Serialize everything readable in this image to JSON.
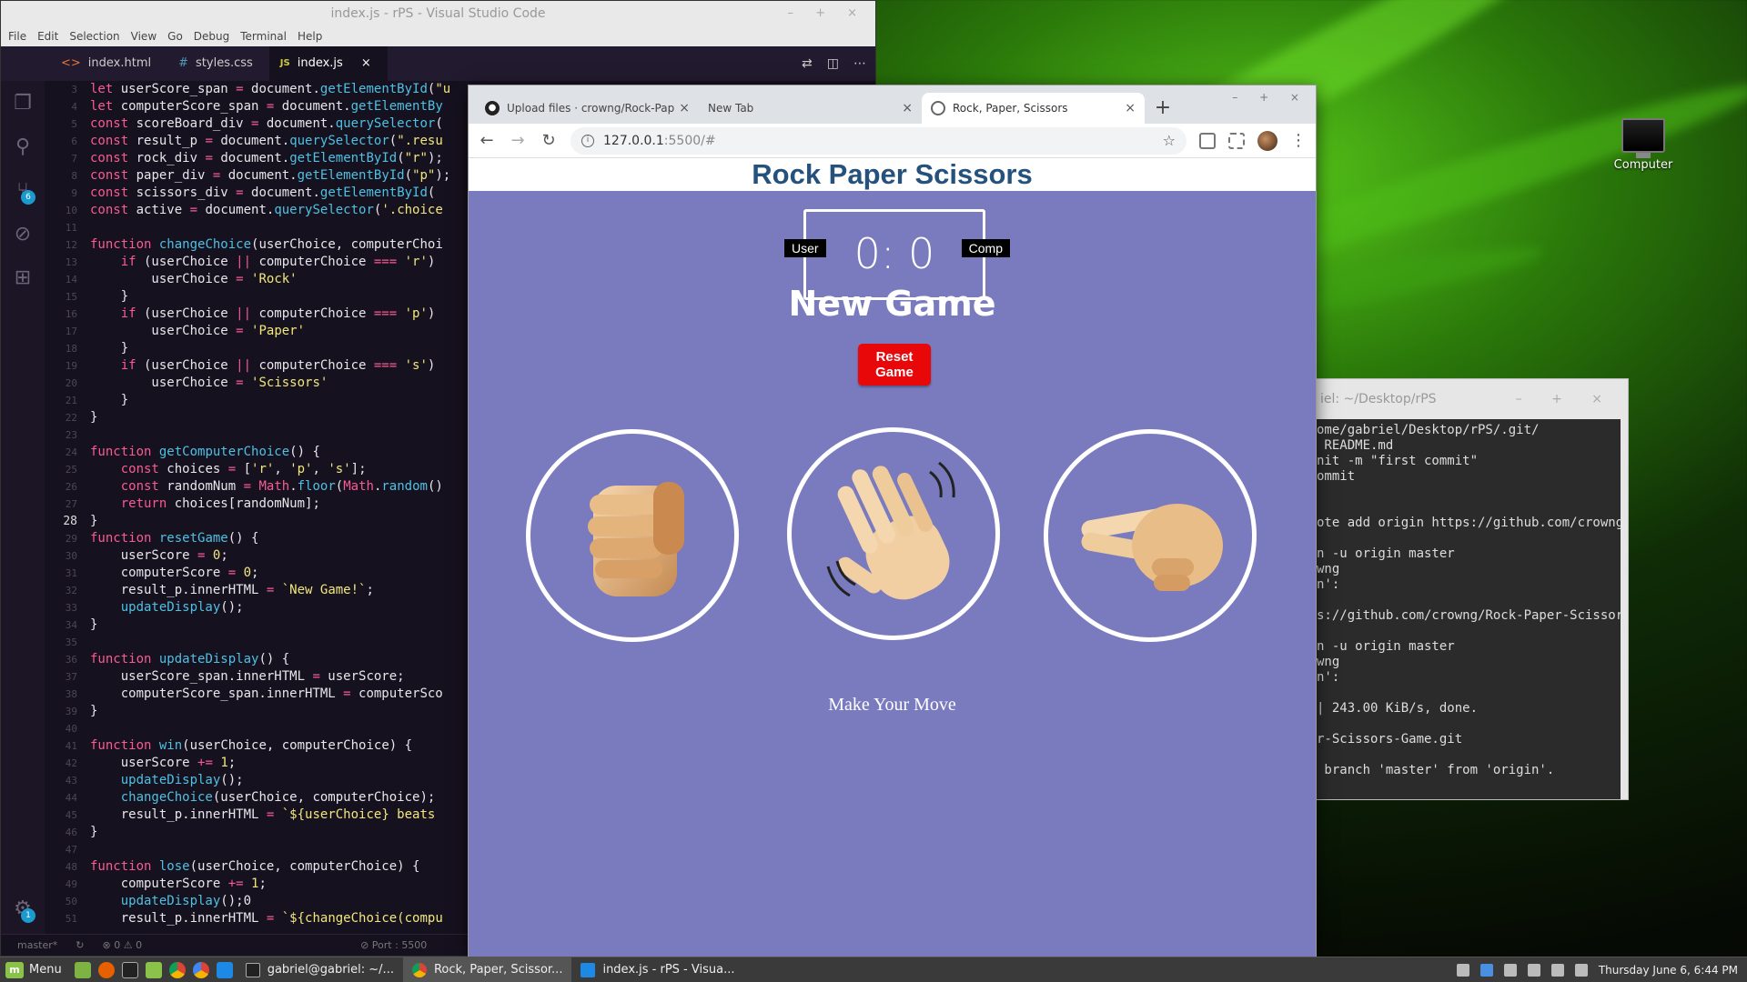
{
  "vscode": {
    "title": "index.js - rPS - Visual Studio Code",
    "window_controls": "– + ×",
    "menu": [
      "File",
      "Edit",
      "Selection",
      "View",
      "Go",
      "Debug",
      "Terminal",
      "Help"
    ],
    "tabs": [
      {
        "icon": "<>",
        "label": "index.html"
      },
      {
        "icon": "#",
        "label": "styles.css"
      },
      {
        "icon": "JS",
        "label": "index.js",
        "close": "×"
      }
    ],
    "scm_badge": "6",
    "settings_badge": "1",
    "status": {
      "branch": "master*",
      "problems": "⊗ 0 ⚠ 0",
      "port": "⊘ Port : 5500"
    },
    "code_lines": [
      {
        "n": "3",
        "html": "<span class=\"kw\">let</span> userScore_span <span class=\"op\">=</span> document.<span class=\"fn\">getElementById</span>(<span class=\"str\">\"u</span>"
      },
      {
        "n": "4",
        "html": "<span class=\"kw\">let</span> computerScore_span <span class=\"op\">=</span> document.<span class=\"fn\">getElementBy</span>"
      },
      {
        "n": "5",
        "html": "<span class=\"kw\">const</span> scoreBoard_div <span class=\"op\">=</span> document.<span class=\"fn\">querySelector</span>("
      },
      {
        "n": "6",
        "html": "<span class=\"kw\">const</span> result_p <span class=\"op\">=</span> document.<span class=\"fn\">querySelector</span>(<span class=\"str\">\".resu</span>"
      },
      {
        "n": "7",
        "html": "<span class=\"kw\">const</span> rock_div <span class=\"op\">=</span> document.<span class=\"fn\">getElementById</span>(<span class=\"str\">\"r\"</span>);"
      },
      {
        "n": "8",
        "html": "<span class=\"kw\">const</span> paper_div <span class=\"op\">=</span> document.<span class=\"fn\">getElementById</span>(<span class=\"str\">\"p\"</span>);"
      },
      {
        "n": "9",
        "html": "<span class=\"kw\">const</span> scissors_div <span class=\"op\">=</span> document.<span class=\"fn\">getElementById</span>("
      },
      {
        "n": "10",
        "html": "<span class=\"kw\">const</span> active <span class=\"op\">=</span> document.<span class=\"fn\">querySelector</span>(<span class=\"str\">'.choice</span>"
      },
      {
        "n": "11",
        "html": ""
      },
      {
        "n": "12",
        "html": "<span class=\"kw\">function</span> <span class=\"fn\">changeChoice</span>(userChoice, computerChoi"
      },
      {
        "n": "13",
        "html": "    <span class=\"kw\">if</span> (userChoice <span class=\"op\">||</span> computerChoice <span class=\"op\">===</span> <span class=\"str\">'r'</span>)"
      },
      {
        "n": "14",
        "html": "        userChoice <span class=\"op\">=</span> <span class=\"str\">'Rock'</span>"
      },
      {
        "n": "15",
        "html": "    }"
      },
      {
        "n": "16",
        "html": "    <span class=\"kw\">if</span> (userChoice <span class=\"op\">||</span> computerChoice <span class=\"op\">===</span> <span class=\"str\">'p'</span>)"
      },
      {
        "n": "17",
        "html": "        userChoice <span class=\"op\">=</span> <span class=\"str\">'Paper'</span>"
      },
      {
        "n": "18",
        "html": "    }"
      },
      {
        "n": "19",
        "html": "    <span class=\"kw\">if</span> (userChoice <span class=\"op\">||</span> computerChoice <span class=\"op\">===</span> <span class=\"str\">'s'</span>)"
      },
      {
        "n": "20",
        "html": "        userChoice <span class=\"op\">=</span> <span class=\"str\">'Scissors'</span>"
      },
      {
        "n": "21",
        "html": "    }"
      },
      {
        "n": "22",
        "html": "}"
      },
      {
        "n": "23",
        "html": ""
      },
      {
        "n": "24",
        "html": "<span class=\"kw\">function</span> <span class=\"fn\">getComputerChoice</span>() {"
      },
      {
        "n": "25",
        "html": "    <span class=\"kw\">const</span> choices <span class=\"op\">=</span> [<span class=\"str\">'r'</span>, <span class=\"str\">'p'</span>, <span class=\"str\">'s'</span>];"
      },
      {
        "n": "26",
        "html": "    <span class=\"kw\">const</span> randomNum <span class=\"op\">=</span> <span class=\"obj\">Math</span>.<span class=\"fn\">floor</span>(<span class=\"obj\">Math</span>.<span class=\"fn\">random</span>()"
      },
      {
        "n": "27",
        "html": "    <span class=\"kw\">return</span> choices[randomNum];"
      },
      {
        "n": "28",
        "html": "}"
      },
      {
        "n": "29",
        "html": "<span class=\"kw\">function</span> <span class=\"fn\">resetGame</span>() {"
      },
      {
        "n": "30",
        "html": "    userScore <span class=\"op\">=</span> <span class=\"num\">0</span>;"
      },
      {
        "n": "31",
        "html": "    computerScore <span class=\"op\">=</span> <span class=\"num\">0</span>;"
      },
      {
        "n": "32",
        "html": "    result_p.innerHTML <span class=\"op\">=</span> <span class=\"str\">`New Game!`</span>;"
      },
      {
        "n": "33",
        "html": "    <span class=\"fn\">updateDisplay</span>();"
      },
      {
        "n": "34",
        "html": "}"
      },
      {
        "n": "35",
        "html": ""
      },
      {
        "n": "36",
        "html": "<span class=\"kw\">function</span> <span class=\"fn\">updateDisplay</span>() {"
      },
      {
        "n": "37",
        "html": "    userScore_span.innerHTML <span class=\"op\">=</span> userScore;"
      },
      {
        "n": "38",
        "html": "    computerScore_span.innerHTML <span class=\"op\">=</span> computerSco"
      },
      {
        "n": "39",
        "html": "}"
      },
      {
        "n": "40",
        "html": ""
      },
      {
        "n": "41",
        "html": "<span class=\"kw\">function</span> <span class=\"fn\">win</span>(userChoice, computerChoice) {"
      },
      {
        "n": "42",
        "html": "    userScore <span class=\"op\">+=</span> <span class=\"num\">1</span>;"
      },
      {
        "n": "43",
        "html": "    <span class=\"fn\">updateDisplay</span>();"
      },
      {
        "n": "44",
        "html": "    <span class=\"fn\">changeChoice</span>(userChoice, computerChoice);"
      },
      {
        "n": "45",
        "html": "    result_p.innerHTML <span class=\"op\">=</span> <span class=\"str\">`${userChoice} beats</span>"
      },
      {
        "n": "46",
        "html": "}"
      },
      {
        "n": "47",
        "html": ""
      },
      {
        "n": "48",
        "html": "<span class=\"kw\">function</span> <span class=\"fn\">lose</span>(userChoice, computerChoice) {"
      },
      {
        "n": "49",
        "html": "    computerScore <span class=\"op\">+=</span> <span class=\"num\">1</span>;"
      },
      {
        "n": "50",
        "html": "    <span class=\"fn\">updateDisplay</span>();0"
      },
      {
        "n": "51",
        "html": "    result_p.innerHTML <span class=\"op\">=</span> <span class=\"str\">`${changeChoice(compu</span>"
      }
    ],
    "current_line": "28"
  },
  "browser": {
    "tabs": [
      {
        "label": "Upload files · crowng/Rock-Pap",
        "favicon": "github"
      },
      {
        "label": "New Tab",
        "favicon": ""
      },
      {
        "label": "Rock, Paper, Scissors",
        "favicon": "globe"
      }
    ],
    "new_tab": "+",
    "url": {
      "host": "127.0.0.1",
      "path": ":5500/#"
    },
    "window_controls": "– + ×"
  },
  "page": {
    "title": "Rock Paper Scissors",
    "user_label": "User",
    "comp_label": "Comp",
    "score": "0: 0",
    "result": "New Game",
    "reset_button": "Reset Game",
    "prompt": "Make Your Move",
    "choices": [
      "rock",
      "paper",
      "scissors"
    ]
  },
  "desktop": {
    "computer_icon_label": "Computer"
  },
  "terminal": {
    "title": "iel: ~/Desktop/rPS",
    "window_controls": "– + ×",
    "lines": [
      "ome/gabriel/Desktop/rPS/.git/",
      " README.md",
      "nit -m \"first commit\"",
      "ommit",
      "",
      "",
      "ote add origin https://github.com/crowng/R",
      "",
      "n -u origin master",
      "wng",
      "n':",
      "",
      "s://github.com/crowng/Rock-Paper-Scissors-",
      "",
      "n -u origin master",
      "wng",
      "n':",
      "",
      "| 243.00 KiB/s, done.",
      "",
      "r-Scissors-Game.git",
      "",
      " branch 'master' from 'origin'."
    ]
  },
  "taskbar": {
    "menu_label": "Menu",
    "items": [
      {
        "label": "gabriel@gabriel: ~/...",
        "active": false
      },
      {
        "label": "Rock, Paper, Scissor...",
        "active": true
      },
      {
        "label": "index.js - rPS - Visua...",
        "active": false
      }
    ],
    "clock": "Thursday June  6, 6:44 PM"
  }
}
